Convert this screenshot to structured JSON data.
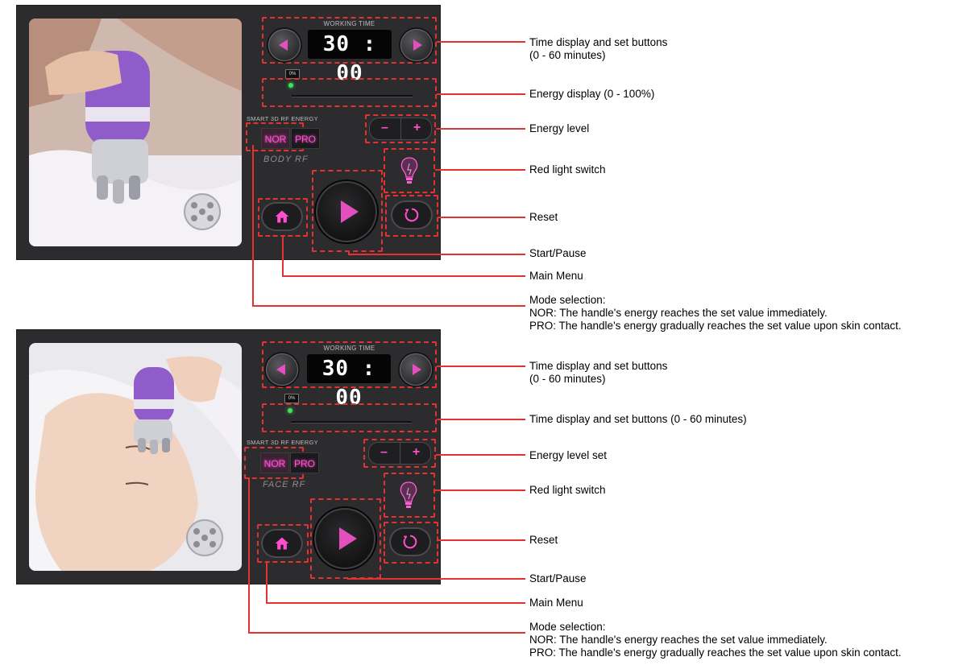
{
  "panels": [
    {
      "id": "top",
      "working_time_label": "WORKING TIME",
      "time": "30 : 00",
      "energy_percent": "0%",
      "smart_label": "SMART 3D RF ENERGY",
      "mode_nor": "NOR",
      "mode_pro": "PRO",
      "mode_sub": "BODY  RF",
      "minus": "–",
      "plus": "+"
    },
    {
      "id": "bottom",
      "working_time_label": "WORKING TIME",
      "time": "30 : 00",
      "energy_percent": "0%",
      "smart_label": "SMART 3D RF ENERGY",
      "mode_nor": "NOR",
      "mode_pro": "PRO",
      "mode_sub": "FACE  RF",
      "minus": "–",
      "plus": "+"
    }
  ],
  "annotations_top": {
    "time_line1": "Time display and set buttons",
    "time_line2": "(0 - 60 minutes)",
    "energy_display": "Energy display (0 - 100%)",
    "energy_level": "Energy level",
    "red_light": "Red light switch",
    "reset": "Reset",
    "start_pause": "Start/Pause",
    "main_menu": "Main Menu",
    "mode_title": "Mode selection:",
    "mode_nor": "NOR: The handle's energy reaches the set value immediately.",
    "mode_pro": "PRO: The handle's energy gradually reaches the set value upon skin contact."
  },
  "annotations_bottom": {
    "time_line1": "Time display and set buttons",
    "time_line2": "(0 - 60 minutes)",
    "energy_display": "Time display and set buttons (0 - 60 minutes)",
    "energy_level": "Energy level set",
    "red_light": "Red light switch",
    "reset": "Reset",
    "start_pause": "Start/Pause",
    "main_menu": "Main Menu",
    "mode_title": "Mode selection:",
    "mode_nor": "NOR: The handle's energy reaches the set value immediately.",
    "mode_pro": "PRO: The handle's energy gradually reaches the set value upon skin contact."
  },
  "colors": {
    "accent": "#e44fc0",
    "callout": "#e23232",
    "panel": "#2c2c2e",
    "energy_dot": "#3ee35a"
  }
}
